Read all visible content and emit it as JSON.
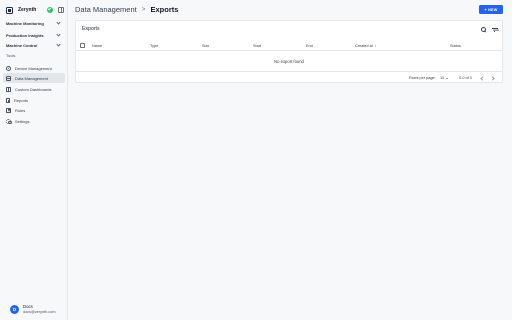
{
  "brand": {
    "name": "Zerynth"
  },
  "sidebar": {
    "groups": [
      {
        "label": "Machine Monitoring"
      },
      {
        "label": "Production Insights"
      },
      {
        "label": "Machine Control"
      }
    ],
    "tools_label": "Tools",
    "items": [
      {
        "label": "Device Management",
        "icon": "gear-icon"
      },
      {
        "label": "Data Management",
        "icon": "database-icon",
        "active": true
      },
      {
        "label": "Custom Dashboards",
        "icon": "dashboard-icon"
      },
      {
        "label": "Reports",
        "icon": "document-icon"
      },
      {
        "label": "Rules",
        "icon": "rules-icon"
      },
      {
        "label": "Settings",
        "icon": "settings-icon"
      }
    ]
  },
  "user": {
    "initial": "D",
    "name": "Docs",
    "email": "docs@zerynth.com"
  },
  "header": {
    "breadcrumb": [
      "Data Management",
      "Exports"
    ],
    "separator": ">",
    "new_button": "+ NEW",
    "accent_color": "#2563eb"
  },
  "exports": {
    "title": "Exports",
    "columns": [
      "Name",
      "Type",
      "Size",
      "Start",
      "End",
      "Created at",
      "Status"
    ],
    "sort_indicator": "↓",
    "empty_text": "No export found",
    "footer": {
      "rows_per_page_label": "Rows per page:",
      "rows_per_page_value": "10",
      "range": "0-0 of 0"
    }
  }
}
